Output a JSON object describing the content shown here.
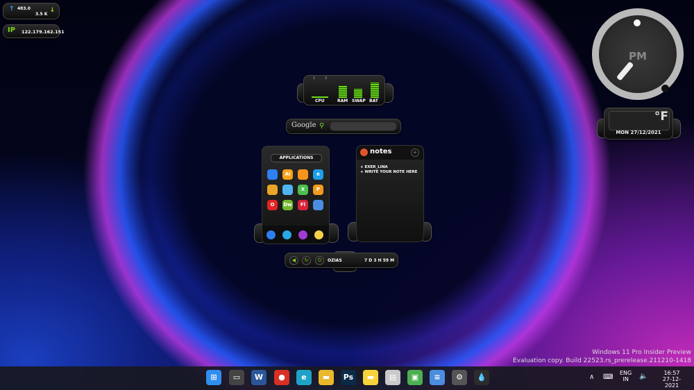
{
  "network": {
    "upload_icon": "arrow-up-icon",
    "download_icon": "arrow-down-icon",
    "upload": "483.0",
    "download": "3.5 K"
  },
  "ip": {
    "label": "IP",
    "address": "122.179.162.151"
  },
  "clock": {
    "ampm": "PM"
  },
  "weather": {
    "unit": "°F",
    "date": "MON 27/12/2021"
  },
  "system": {
    "meters": [
      {
        "label": "CPU",
        "value": 0.05
      },
      {
        "label": "RAM",
        "value": 0.8
      },
      {
        "label": "SWAP",
        "value": 0.6
      },
      {
        "label": "BAT",
        "value": 1.0
      }
    ],
    "cores": [
      "1",
      "2"
    ]
  },
  "google": {
    "label": "Google",
    "placeholder": ""
  },
  "applications": {
    "title": "APPLICATIONS",
    "icons": [
      {
        "name": "messenger-icon",
        "text": "",
        "color": "#2e7ff2"
      },
      {
        "name": "illustrator-icon",
        "text": "Ai",
        "color": "#f7a21b"
      },
      {
        "name": "firefox-icon",
        "text": "",
        "color": "#f7941d"
      },
      {
        "name": "ie-icon",
        "text": "e",
        "color": "#1e9fe8"
      },
      {
        "name": "chrome-icon",
        "text": "",
        "color": "#e8a52a"
      },
      {
        "name": "twitter-icon",
        "text": "",
        "color": "#4fb4ef"
      },
      {
        "name": "excel-icon",
        "text": "X",
        "color": "#4bbf4f"
      },
      {
        "name": "powerpoint-icon",
        "text": "P",
        "color": "#f39a1e"
      },
      {
        "name": "opera-icon",
        "text": "O",
        "color": "#e02424"
      },
      {
        "name": "dreamweaver-icon",
        "text": "Dw",
        "color": "#74b82f"
      },
      {
        "name": "fireworks-icon",
        "text": "Fl",
        "color": "#d8243a"
      },
      {
        "name": "disk-icon",
        "text": "",
        "color": "#4b8de0"
      }
    ],
    "dock": [
      {
        "name": "finder-icon",
        "color": "#2d7ff0"
      },
      {
        "name": "globe-icon",
        "color": "#2aa7e6"
      },
      {
        "name": "gamepad-icon",
        "color": "#a23bd6"
      },
      {
        "name": "notes-app-icon",
        "color": "#f2d04a"
      }
    ]
  },
  "notes": {
    "title": "notes",
    "lines": [
      "+ EXER_LINA",
      "+ WRITE YOUR NOTE HERE"
    ]
  },
  "power": {
    "user": "OZIAS",
    "uptime": "7 D 3 H 59 M"
  },
  "watermark": {
    "line1": "Windows 11 Pro Insider Preview",
    "line2": "Evaluation copy. Build 22523.rs_prerelease.211210-1418"
  },
  "taskbar": {
    "apps": [
      {
        "name": "start-icon",
        "text": "⊞",
        "color": "#2f8ef0"
      },
      {
        "name": "task-view-icon",
        "text": "▭",
        "color": "#444"
      },
      {
        "name": "word-icon",
        "text": "W",
        "color": "#2b579a"
      },
      {
        "name": "chrome-icon",
        "text": "●",
        "color": "#d93025"
      },
      {
        "name": "edge-icon",
        "text": "e",
        "color": "#1fa2c7"
      },
      {
        "name": "file-explorer-icon",
        "text": "▬",
        "color": "#e9b82c"
      },
      {
        "name": "photoshop-icon",
        "text": "Ps",
        "color": "#0a2a48"
      },
      {
        "name": "sticky-notes-icon",
        "text": "▬",
        "color": "#f7d23b"
      },
      {
        "name": "tool-icon",
        "text": "▤",
        "color": "#c9c9c9"
      },
      {
        "name": "image-editor-icon",
        "text": "▣",
        "color": "#4caf50"
      },
      {
        "name": "notepad-icon",
        "text": "≡",
        "color": "#4b8de0"
      },
      {
        "name": "settings-icon",
        "text": "⚙",
        "color": "#555"
      },
      {
        "name": "droplet-icon",
        "text": "💧",
        "color": "#2c2c2c"
      }
    ],
    "tray": {
      "lang": "ENG",
      "region": "IN",
      "time": "16:57",
      "date": "27-12-2021"
    }
  }
}
